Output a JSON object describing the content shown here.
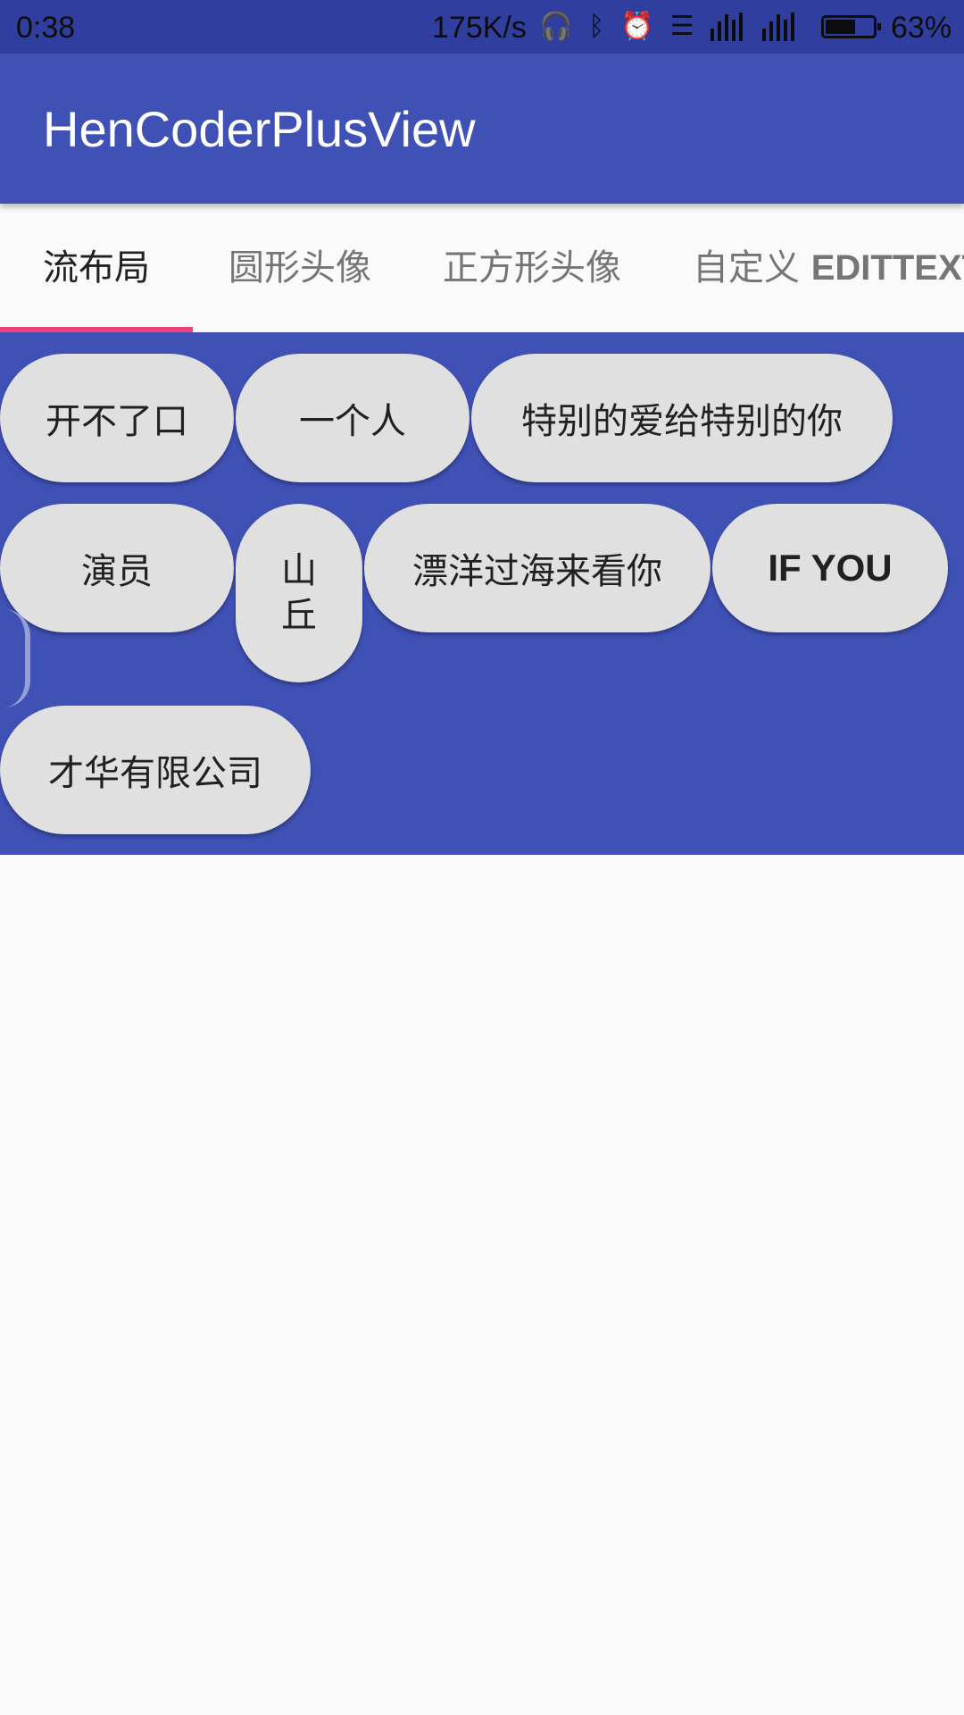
{
  "status_bar": {
    "time": "0:38",
    "net_speed": "175K/s",
    "battery_percent": "63%",
    "battery_level": 0.63,
    "icons": [
      "headset-icon",
      "bluetooth-icon",
      "alarm-icon",
      "data-icon",
      "signal-icon",
      "signal-icon"
    ]
  },
  "app_bar": {
    "title": "HenCoderPlusView"
  },
  "tabs": [
    {
      "label": "流布局",
      "latin": ""
    },
    {
      "label": "圆形头像",
      "latin": ""
    },
    {
      "label": "正方形头像",
      "latin": ""
    },
    {
      "label": "自定义 ",
      "latin": "EDITTEXT"
    }
  ],
  "active_tab": 0,
  "flow_items": [
    "开不了口",
    "一个人",
    "特别的爱给特别的你",
    "演员",
    "山丘",
    "漂洋过海来看你",
    "IF YOU",
    "才华有限公司"
  ],
  "colors": {
    "status_bar": "#303f9f",
    "primary": "#3f51b5",
    "accent": "#ec407a",
    "chip": "#e0e0e0"
  }
}
